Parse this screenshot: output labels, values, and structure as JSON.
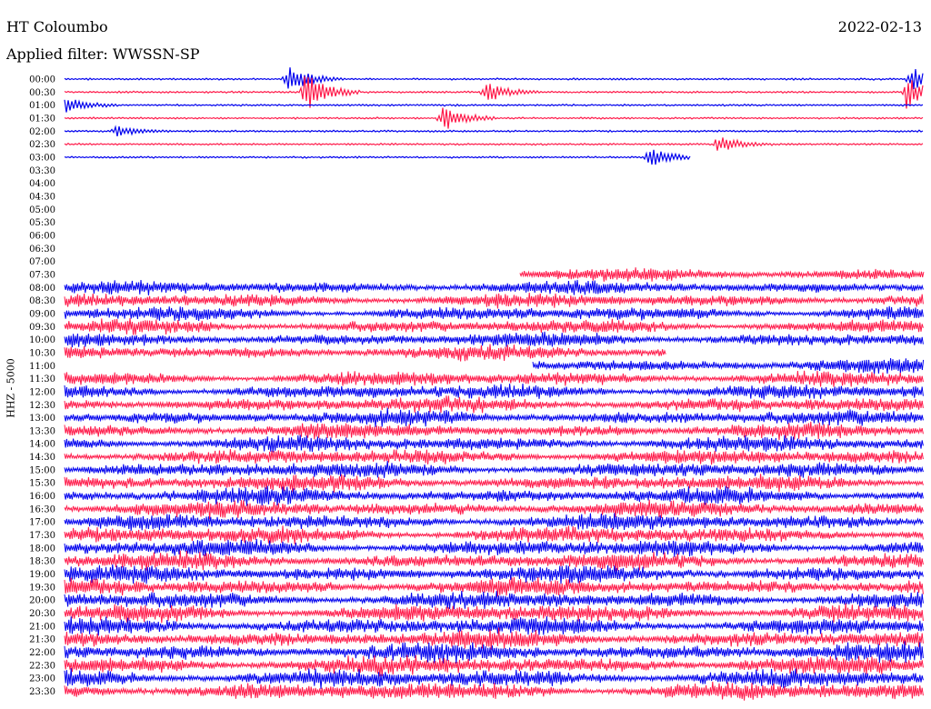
{
  "header": {
    "station": "HT Coloumbo",
    "date": "2022-02-13",
    "filter_text": "Applied filter: WWSSN-SP"
  },
  "colors": {
    "trace_a": "#0000ee",
    "trace_b": "#ff1a4a",
    "background": "#ffffff"
  },
  "chart_data": {
    "type": "helicorder",
    "title": "HT Coloumbo",
    "ylabel": "HHZ - 5000",
    "row_labels": [
      "00:00",
      "00:30",
      "01:00",
      "01:30",
      "02:00",
      "02:30",
      "03:00",
      "03:30",
      "04:00",
      "04:30",
      "05:00",
      "05:30",
      "06:00",
      "06:30",
      "07:00",
      "07:30",
      "08:00",
      "08:30",
      "09:00",
      "09:30",
      "10:00",
      "10:30",
      "11:00",
      "11:30",
      "12:00",
      "12:30",
      "13:00",
      "13:30",
      "14:00",
      "14:30",
      "15:00",
      "15:30",
      "16:00",
      "16:30",
      "17:00",
      "17:30",
      "18:00",
      "18:30",
      "19:00",
      "19:30",
      "20:00",
      "20:30",
      "21:00",
      "21:30",
      "22:00",
      "22:30",
      "23:00",
      "23:30"
    ],
    "row_colors": [
      "blue",
      "red"
    ],
    "coverage": [
      {
        "row": "00:00",
        "from": 0,
        "to": 1
      },
      {
        "row": "00:30",
        "from": 0,
        "to": 1
      },
      {
        "row": "01:00",
        "from": 0,
        "to": 1
      },
      {
        "row": "01:30",
        "from": 0,
        "to": 1
      },
      {
        "row": "02:00",
        "from": 0,
        "to": 1
      },
      {
        "row": "02:30",
        "from": 0,
        "to": 1
      },
      {
        "row": "03:00",
        "from": 0,
        "to": 0.73
      },
      {
        "row": "07:30",
        "from": 0.53,
        "to": 1
      },
      {
        "row": "08:00",
        "from": 0,
        "to": 1
      },
      {
        "row": "08:30",
        "from": 0,
        "to": 1
      },
      {
        "row": "09:00",
        "from": 0,
        "to": 1
      },
      {
        "row": "09:30",
        "from": 0,
        "to": 1
      },
      {
        "row": "10:00",
        "from": 0,
        "to": 1
      },
      {
        "row": "10:30",
        "from": 0,
        "to": 0.7
      },
      {
        "row": "11:00",
        "from": 0.545,
        "to": 1
      },
      {
        "row": "11:30",
        "from": 0,
        "to": 1
      },
      {
        "row": "12:00",
        "from": 0,
        "to": 1
      },
      {
        "row": "12:30",
        "from": 0,
        "to": 1
      },
      {
        "row": "13:00",
        "from": 0,
        "to": 1
      },
      {
        "row": "13:30",
        "from": 0,
        "to": 1
      },
      {
        "row": "14:00",
        "from": 0,
        "to": 1
      },
      {
        "row": "14:30",
        "from": 0,
        "to": 1
      },
      {
        "row": "15:00",
        "from": 0,
        "to": 1
      },
      {
        "row": "15:30",
        "from": 0,
        "to": 1
      },
      {
        "row": "16:00",
        "from": 0,
        "to": 1
      },
      {
        "row": "16:30",
        "from": 0,
        "to": 1
      },
      {
        "row": "17:00",
        "from": 0,
        "to": 1
      },
      {
        "row": "17:30",
        "from": 0,
        "to": 1
      },
      {
        "row": "18:00",
        "from": 0,
        "to": 1
      },
      {
        "row": "18:30",
        "from": 0,
        "to": 1
      },
      {
        "row": "19:00",
        "from": 0,
        "to": 1
      },
      {
        "row": "19:30",
        "from": 0,
        "to": 1
      },
      {
        "row": "20:00",
        "from": 0,
        "to": 1
      },
      {
        "row": "20:30",
        "from": 0,
        "to": 1
      },
      {
        "row": "21:00",
        "from": 0,
        "to": 1
      },
      {
        "row": "21:30",
        "from": 0,
        "to": 1
      },
      {
        "row": "22:00",
        "from": 0,
        "to": 1
      },
      {
        "row": "22:30",
        "from": 0,
        "to": 1
      },
      {
        "row": "23:00",
        "from": 0,
        "to": 1
      },
      {
        "row": "23:30",
        "from": 0,
        "to": 1
      }
    ],
    "events": [
      {
        "row": "00:00",
        "at": 0.26,
        "strength": 2.5
      },
      {
        "row": "00:00",
        "at": 0.985,
        "strength": 2.2
      },
      {
        "row": "00:30",
        "at": 0.28,
        "strength": 3.5
      },
      {
        "row": "00:30",
        "at": 0.49,
        "strength": 2.0
      },
      {
        "row": "00:30",
        "at": 0.98,
        "strength": 3.0
      },
      {
        "row": "01:00",
        "at": 0.0,
        "strength": 1.5
      },
      {
        "row": "01:30",
        "at": 0.44,
        "strength": 2.5
      },
      {
        "row": "02:00",
        "at": 0.06,
        "strength": 1.0
      },
      {
        "row": "02:30",
        "at": 0.76,
        "strength": 1.5
      },
      {
        "row": "03:00",
        "at": 0.68,
        "strength": 1.8
      }
    ]
  }
}
